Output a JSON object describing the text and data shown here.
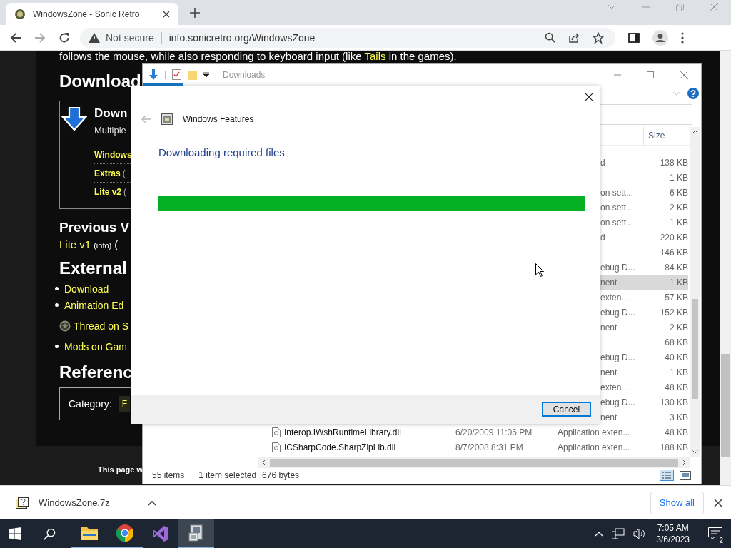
{
  "browser": {
    "tabs": [
      {
        "title": "WindowsZone - Sonic Retro",
        "selected": true
      }
    ],
    "address": {
      "security": "Not secure",
      "url": "info.sonicretro.org/WindowsZone"
    }
  },
  "page": {
    "intro": {
      "before": "follows the mouse, while also responding to keyboard input (like",
      "link": "Tails",
      "after": "in the games)."
    },
    "download_heading": "Download",
    "download_box": {
      "title": "Down",
      "subtitle": "Multiple",
      "links": [
        {
          "label": "Windows"
        },
        {
          "label": "Extras",
          "note": "("
        },
        {
          "label": "Lite v2",
          "note": "("
        }
      ]
    },
    "previous_heading": "Previous V",
    "previous_item": {
      "link": "Lite v1",
      "sup": "(info)",
      "rest": "("
    },
    "external_heading": "External",
    "external_links": [
      {
        "label": "Download",
        "kind": "bullet"
      },
      {
        "label": "Animation Ed",
        "kind": "bullet"
      },
      {
        "label": "Thread on S",
        "kind": "forum"
      },
      {
        "label": "Mods on Gam",
        "kind": "bullet"
      }
    ],
    "references_heading": "Referenc",
    "category": {
      "label": "Category:",
      "tag": "F"
    },
    "footer": "This page w"
  },
  "explorer": {
    "title": "Downloads",
    "size_header": "Size",
    "rows": [
      {
        "type": "d",
        "size": "138 KB",
        "selected": false
      },
      {
        "size": "1 KB",
        "selected": false
      },
      {
        "type": "on sett...",
        "size": "6 KB",
        "selected": false
      },
      {
        "type": "on sett...",
        "size": "2 KB",
        "selected": false
      },
      {
        "type": "on sett...",
        "size": "1 KB",
        "selected": false
      },
      {
        "type": "d",
        "size": "220 KB",
        "selected": false
      },
      {
        "size": "146 KB",
        "selected": false
      },
      {
        "type": "ebug D...",
        "size": "84 KB",
        "selected": false
      },
      {
        "type": "nent",
        "size": "1 KB",
        "selected": true
      },
      {
        "type": "exten...",
        "size": "57 KB",
        "selected": false
      },
      {
        "type": "ebug D...",
        "size": "152 KB",
        "selected": false
      },
      {
        "type": "nent",
        "size": "2 KB",
        "selected": false
      },
      {
        "size": "68 KB",
        "selected": false
      },
      {
        "type": "ebug D...",
        "size": "40 KB",
        "selected": false
      },
      {
        "type": "nent",
        "size": "1 KB",
        "selected": false
      },
      {
        "type": "exten...",
        "size": "48 KB",
        "selected": false
      },
      {
        "type": "ebug D...",
        "size": "130 KB",
        "selected": false
      },
      {
        "type": "nent",
        "size": "3 KB",
        "selected": false
      },
      {
        "name": "Interop.IWshRuntimeLibrary.dll",
        "date": "6/20/2009 11:06 PM",
        "type": "Application exten...",
        "size": "48 KB",
        "selected": false
      },
      {
        "name": "ICSharpCode.SharpZipLib.dll",
        "date": "8/7/2008 8:31 PM",
        "type": "Application exten...",
        "size": "188 KB",
        "selected": false
      }
    ],
    "status": {
      "count": "55 items",
      "selection": "1 item selected",
      "size": "676 bytes"
    }
  },
  "dialog": {
    "title": "Windows Features",
    "heading": "Downloading required files",
    "progress": {
      "level": 1
    },
    "cancel": "Cancel"
  },
  "downloads_bar": {
    "file": "WindowsZone.7z",
    "show_all": "Show all"
  },
  "taskbar": {
    "apps": [
      {
        "kind": "explorer",
        "running": true,
        "active": false
      },
      {
        "kind": "chrome",
        "running": true,
        "active": false
      },
      {
        "kind": "studio",
        "running": false,
        "active": false
      },
      {
        "kind": "setup",
        "running": true,
        "active": true
      }
    ],
    "time": "7:05 AM",
    "date": "3/6/2023",
    "notifications": "2"
  }
}
